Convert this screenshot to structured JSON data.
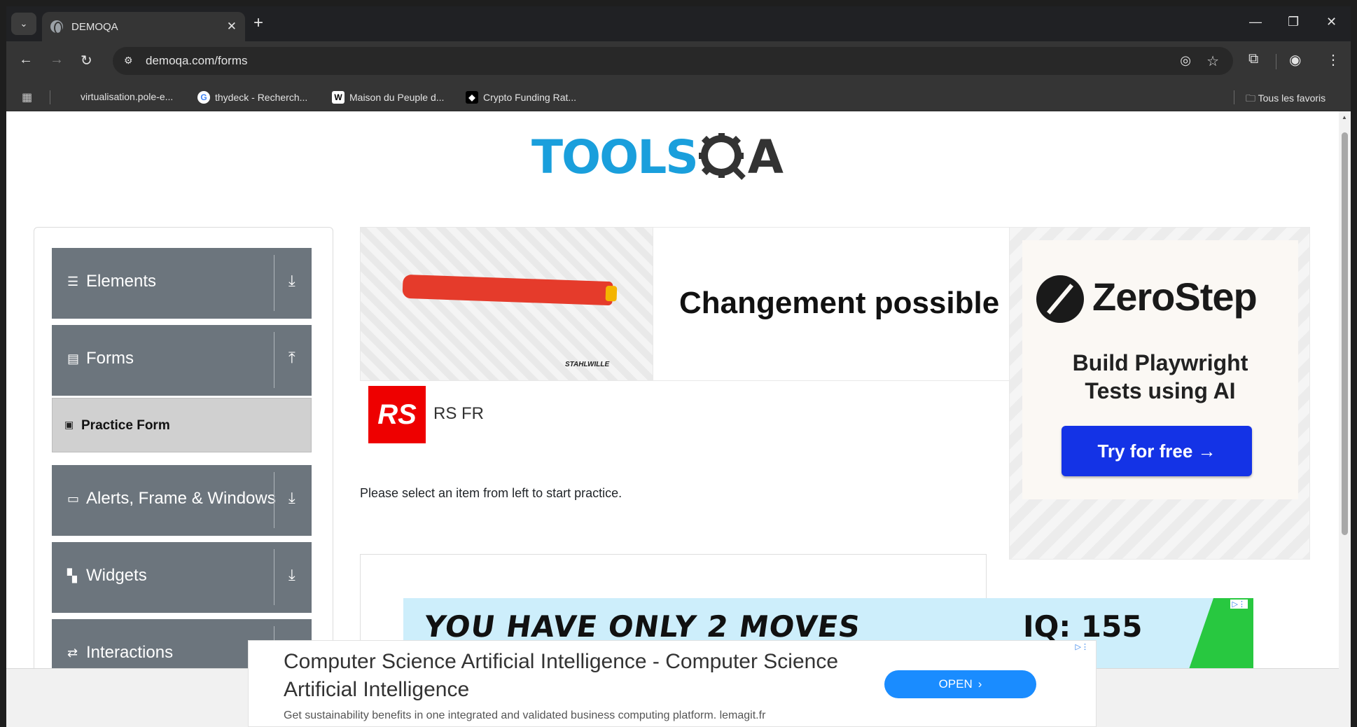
{
  "browser": {
    "tab_title": "DEMOQA",
    "url": "demoqa.com/forms",
    "bookmarks": [
      {
        "label": "virtualisation.pole-e...",
        "icon": "blank"
      },
      {
        "label": "thydeck - Recherch...",
        "icon": "google"
      },
      {
        "label": "Maison du Peuple d...",
        "icon": "wikipedia"
      },
      {
        "label": "Crypto Funding Rat...",
        "icon": "crypto"
      }
    ],
    "all_bookmarks_label": "Tous les favoris"
  },
  "logo": {
    "tools": "TOOLS",
    "a": "A"
  },
  "sidebar": {
    "groups": [
      {
        "label": "Elements",
        "icon": "hamburger-icon",
        "arrow": "download-icon"
      },
      {
        "label": "Forms",
        "icon": "document-icon",
        "arrow": "upload-icon"
      },
      {
        "label": "Alerts, Frame & Windows",
        "icon": "window-icon",
        "arrow": "download-icon"
      },
      {
        "label": "Widgets",
        "icon": "widgets-icon",
        "arrow": "download-icon"
      },
      {
        "label": "Interactions",
        "icon": "interactions-icon",
        "arrow": "download-icon"
      }
    ],
    "active_subitem": "Practice Form"
  },
  "ads": {
    "top": {
      "headline": "Changement possible du",
      "brand": "STAHLWILLE",
      "advertiser_logo": "RS",
      "advertiser_name": "RS FR"
    },
    "zerostep": {
      "name": "ZeroStep",
      "tagline_1": "Build Playwright",
      "tagline_2": "Tests using AI",
      "cta": "Try for free →"
    },
    "game": {
      "headline": "YOU HAVE ONLY 2 MOVES",
      "iq": "IQ: 155"
    },
    "bottom": {
      "title": "Computer Science Artificial Intelligence - Computer Science Artificial Intelligence",
      "subtitle": "Get sustainability benefits in one integrated and validated business computing platform. lemagit.fr",
      "cta": "OPEN"
    }
  },
  "main": {
    "instruction": "Please select an item from left to start practice."
  },
  "colors": {
    "sidebar_group_bg": "#6c757d",
    "logo_blue": "#1a9fdc",
    "zerostep_button": "#1433e6",
    "open_button": "#1a8cff"
  }
}
